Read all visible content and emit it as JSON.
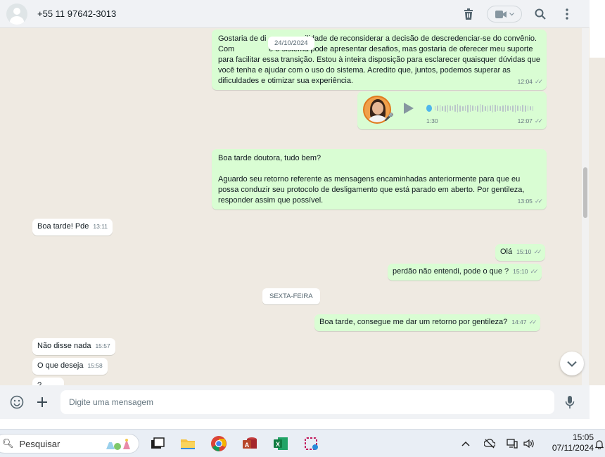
{
  "header": {
    "contact_name": "+55 11 97642-3013",
    "icons": [
      "trash-icon",
      "video-call-icon",
      "search-icon",
      "menu-icon"
    ]
  },
  "messages": {
    "date_1": "24/10/2024",
    "msg_1_text": "Gostaria de di                  ilidade de reconsiderar a decisão de descredenciar-se do convênio.  Com                e o sistema pode apresentar desafios, mas gostaria de oferecer meu suporte para facilitar essa transição. Estou à inteira disposição para esclarecer quaisquer dúvidas que você tenha e ajudar com o uso do sistema. Acredito que, juntos, podemos superar as dificuldades e otimizar sua experiência.",
    "msg_1_time": "12:04",
    "audio_duration": "1:30",
    "audio_time": "12:07",
    "audio_progress": 0,
    "msg_3_line1": "Boa tarde doutora, tudo bem?",
    "msg_3_line2": "Aguardo seu retorno referente as mensagens encaminhadas anteriormente para que eu possa conduzir seu protocolo de desligamento que está parado em aberto. Por gentileza, responder assim que possível.",
    "msg_3_time": "13:05",
    "msg_4_text": "Boa tarde! Pde",
    "msg_4_time": "13:11",
    "msg_5_text": "Olá",
    "msg_5_time": "15:10",
    "msg_6_text": "perdão não entendi, pode o que ?",
    "msg_6_time": "15:10",
    "date_2": "SEXTA-FEIRA",
    "msg_7_text": "Boa tarde, consegue me dar um retorno por gentileza?",
    "msg_7_time": "14:47",
    "msg_8_text": "Não disse nada",
    "msg_8_time": "15:57",
    "msg_9_text": "O que deseja",
    "msg_9_time": "15:58",
    "msg_10_text": "?"
  },
  "composer": {
    "placeholder": "Digite uma mensagem"
  },
  "taskbar": {
    "search_label": "Pesquisar",
    "time": "15:05",
    "date": "07/11/2024"
  },
  "colors": {
    "outgoing_bubble": "#d9fdd3",
    "incoming_bubble": "#ffffff",
    "chat_background": "#efeae2",
    "audio_dot": "#4fb6ec"
  }
}
